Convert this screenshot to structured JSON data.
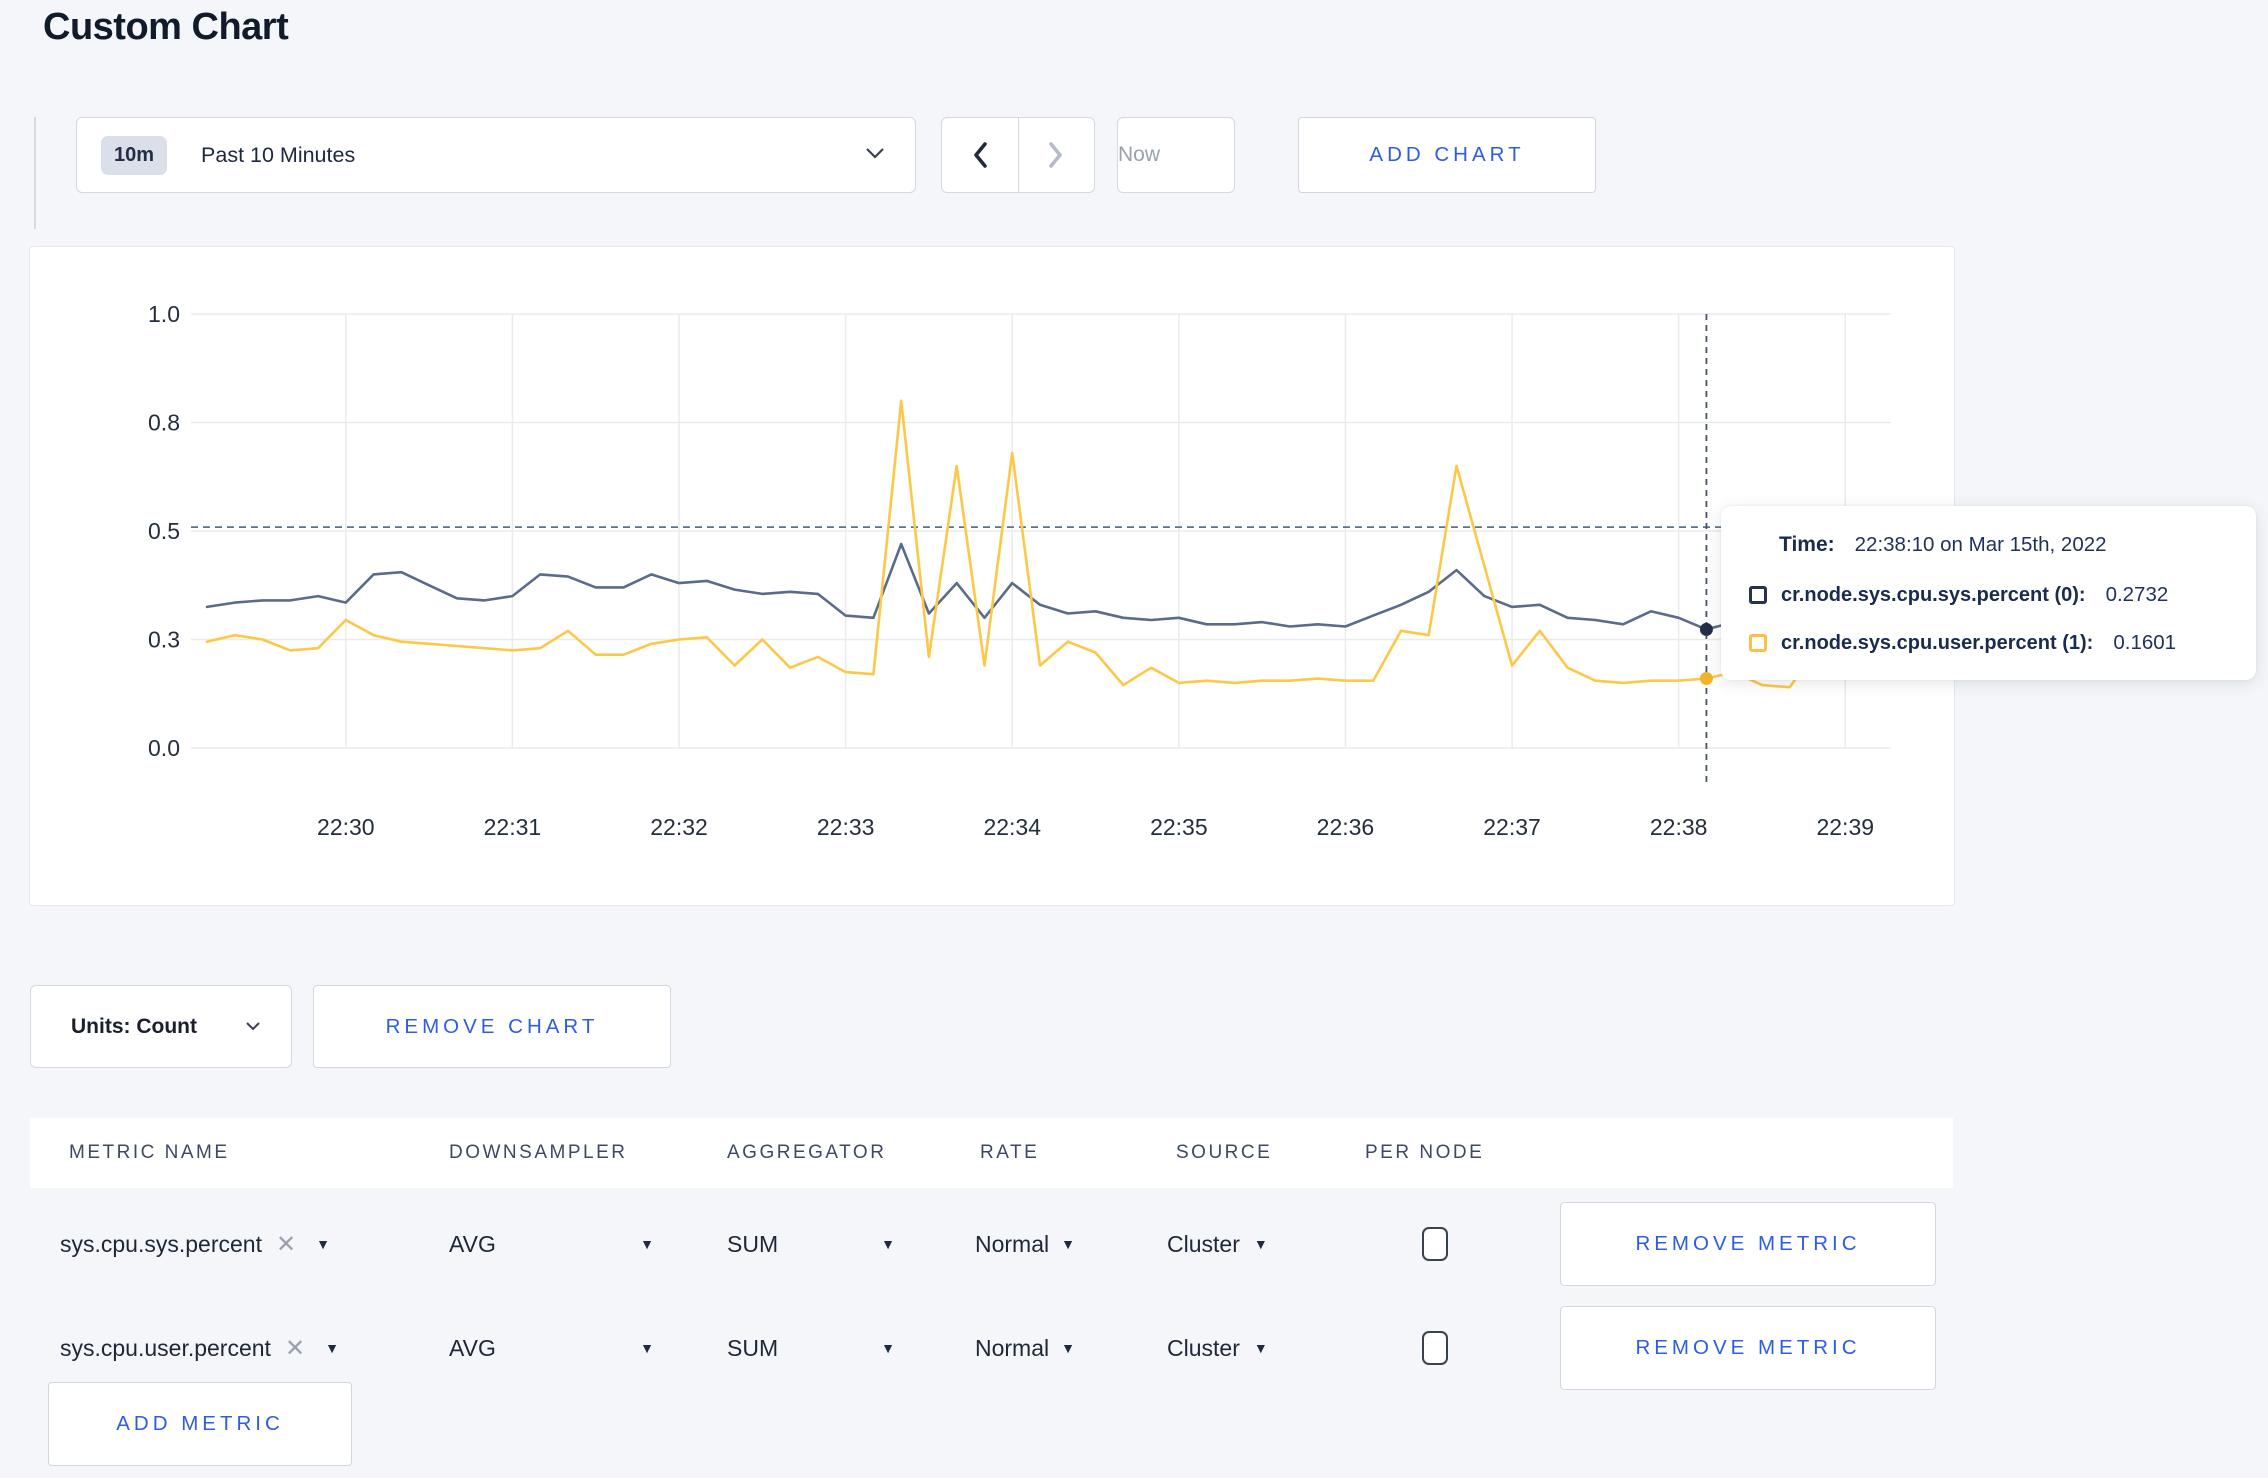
{
  "page": {
    "title": "Custom Chart"
  },
  "toolbar": {
    "range_badge": "10m",
    "range_label": "Past 10 Minutes",
    "now_label": "Now",
    "add_chart_label": "ADD CHART"
  },
  "chart_data": {
    "type": "line",
    "title": "",
    "xlabel": "",
    "ylabel": "",
    "ylim": [
      0,
      1
    ],
    "grid": true,
    "x_unit": "seconds since 22:29:10",
    "x_ticks": [
      {
        "t": 50,
        "label": "22:30"
      },
      {
        "t": 110,
        "label": "22:31"
      },
      {
        "t": 170,
        "label": "22:32"
      },
      {
        "t": 230,
        "label": "22:33"
      },
      {
        "t": 290,
        "label": "22:34"
      },
      {
        "t": 350,
        "label": "22:35"
      },
      {
        "t": 410,
        "label": "22:36"
      },
      {
        "t": 470,
        "label": "22:37"
      },
      {
        "t": 530,
        "label": "22:38"
      },
      {
        "t": 590,
        "label": "22:39"
      }
    ],
    "y_ticks": [
      {
        "v": 0,
        "label": "0.0"
      },
      {
        "v": 0.25,
        "label": "0.3"
      },
      {
        "v": 0.5,
        "label": "0.5"
      },
      {
        "v": 0.75,
        "label": "0.8"
      },
      {
        "v": 1,
        "label": "1.0"
      }
    ],
    "series": [
      {
        "name": "cr.node.sys.cpu.sys.percent",
        "color": "#5b6b89",
        "t0": 0,
        "dt": 10,
        "values": [
          0.325,
          0.335,
          0.34,
          0.34,
          0.35,
          0.335,
          0.4,
          0.405,
          0.375,
          0.345,
          0.34,
          0.35,
          0.4,
          0.395,
          0.37,
          0.37,
          0.4,
          0.38,
          0.385,
          0.365,
          0.355,
          0.36,
          0.355,
          0.305,
          0.3,
          0.47,
          0.31,
          0.38,
          0.3,
          0.38,
          0.33,
          0.31,
          0.315,
          0.3,
          0.295,
          0.3,
          0.285,
          0.285,
          0.29,
          0.28,
          0.285,
          0.28,
          0.305,
          0.33,
          0.36,
          0.41,
          0.35,
          0.325,
          0.33,
          0.3,
          0.295,
          0.285,
          0.315,
          0.3,
          0.2732,
          0.29,
          0.3,
          0.295,
          0.285,
          0.29,
          0.3,
          0.305
        ]
      },
      {
        "name": "cr.node.sys.cpu.user.percent",
        "color": "#fdc748",
        "t0": 0,
        "dt": 10,
        "values": [
          0.245,
          0.26,
          0.25,
          0.225,
          0.23,
          0.295,
          0.26,
          0.245,
          0.24,
          0.235,
          0.23,
          0.225,
          0.23,
          0.27,
          0.215,
          0.215,
          0.24,
          0.25,
          0.255,
          0.19,
          0.25,
          0.185,
          0.21,
          0.175,
          0.17,
          0.8,
          0.21,
          0.65,
          0.19,
          0.68,
          0.19,
          0.245,
          0.22,
          0.145,
          0.185,
          0.15,
          0.155,
          0.15,
          0.155,
          0.155,
          0.16,
          0.155,
          0.155,
          0.27,
          0.26,
          0.65,
          0.42,
          0.19,
          0.27,
          0.185,
          0.155,
          0.15,
          0.155,
          0.155,
          0.1601,
          0.175,
          0.145,
          0.14,
          0.23,
          0.32,
          0.2,
          0.26
        ]
      }
    ],
    "guide": {
      "y": 0.509,
      "color": "#5d7389"
    },
    "crosshair": {
      "t": 540,
      "color": "#44546a",
      "points": [
        {
          "v": 0.2732,
          "color": "#232f49"
        },
        {
          "v": 0.1601,
          "color": "#efb42a"
        }
      ]
    },
    "axis_color": "#252e3d",
    "gridline_color": "#ebebeb",
    "legend_position": "tooltip"
  },
  "tooltip": {
    "time_label": "Time:",
    "time_value": "22:38:10 on Mar 15th, 2022",
    "series": [
      {
        "name": "cr.node.sys.cpu.sys.percent (0):",
        "value": "0.2732",
        "color": "#26334d"
      },
      {
        "name": "cr.node.sys.cpu.user.percent (1):",
        "value": "0.1601",
        "color": "#fdc044"
      }
    ]
  },
  "chart_controls": {
    "units_label": "Units: Count",
    "remove_chart_label": "REMOVE CHART"
  },
  "metrics_table": {
    "headers": [
      "METRIC NAME",
      "DOWNSAMPLER",
      "AGGREGATOR",
      "RATE",
      "SOURCE",
      "PER NODE"
    ],
    "rows": [
      {
        "metric": "sys.cpu.sys.percent",
        "downsampler": "AVG",
        "aggregator": "SUM",
        "rate": "Normal",
        "source": "Cluster",
        "per_node_checked": false,
        "remove_label": "REMOVE METRIC"
      },
      {
        "metric": "sys.cpu.user.percent",
        "downsampler": "AVG",
        "aggregator": "SUM",
        "rate": "Normal",
        "source": "Cluster",
        "per_node_checked": false,
        "remove_label": "REMOVE METRIC"
      }
    ],
    "add_metric_label": "ADD METRIC"
  }
}
